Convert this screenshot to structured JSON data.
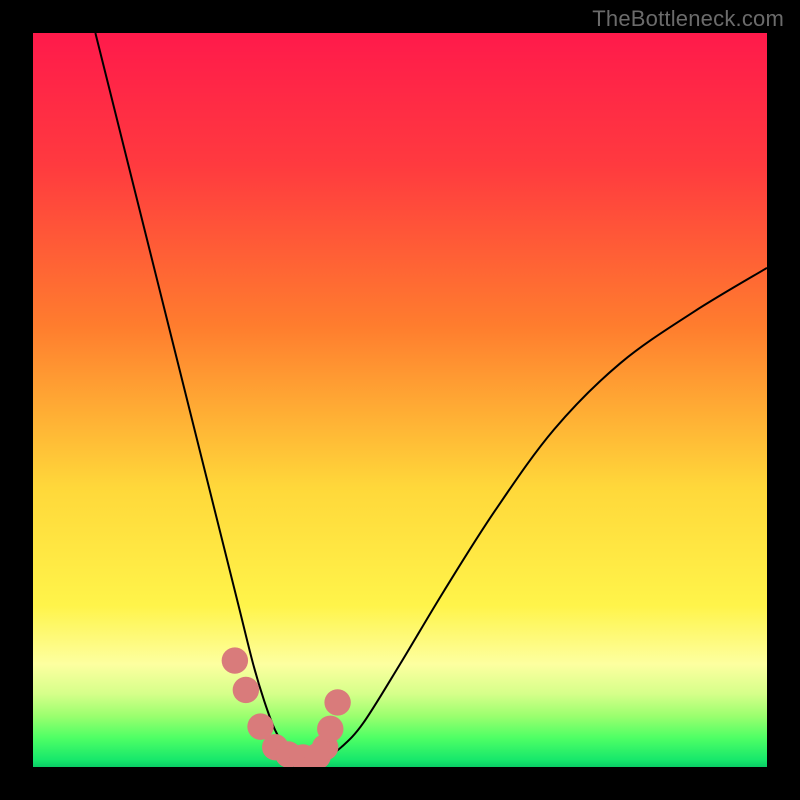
{
  "watermark": "TheBottleneck.com",
  "chart_data": {
    "type": "line",
    "title": "",
    "xlabel": "",
    "ylabel": "",
    "xlim": [
      0,
      100
    ],
    "ylim": [
      0,
      100
    ],
    "grid": false,
    "legend": false,
    "gradient_stops": [
      {
        "pct": 0,
        "color": "#ff1a4b"
      },
      {
        "pct": 18,
        "color": "#ff3a3f"
      },
      {
        "pct": 40,
        "color": "#ff7d2e"
      },
      {
        "pct": 62,
        "color": "#ffd83a"
      },
      {
        "pct": 78,
        "color": "#fff44a"
      },
      {
        "pct": 86,
        "color": "#fdffa0"
      },
      {
        "pct": 90,
        "color": "#d6ff8a"
      },
      {
        "pct": 93,
        "color": "#9cff6f"
      },
      {
        "pct": 96,
        "color": "#4fff65"
      },
      {
        "pct": 99,
        "color": "#17e86b"
      },
      {
        "pct": 100,
        "color": "#0acd65"
      }
    ],
    "series": [
      {
        "name": "bottleneck-curve",
        "color": "#000000",
        "width": 2,
        "x": [
          8.5,
          11,
          14,
          17,
          20,
          23,
          26,
          28,
          30,
          31.5,
          33,
          34.5,
          36,
          38,
          40,
          42,
          45,
          50,
          56,
          63,
          71,
          80,
          90,
          100
        ],
        "y": [
          100,
          90,
          78,
          66,
          54,
          42,
          30,
          22,
          14,
          9,
          5,
          2.7,
          1.7,
          1.3,
          1.5,
          2.7,
          6,
          14,
          24,
          35,
          46,
          55,
          62,
          68
        ]
      }
    ],
    "markers": {
      "name": "data-points",
      "color": "#d97b7b",
      "radius_frac": 0.018,
      "x": [
        27.5,
        29.0,
        31.0,
        33.0,
        34.8,
        36.8,
        38.8,
        39.8,
        40.5,
        41.5
      ],
      "y": [
        14.5,
        10.5,
        5.5,
        2.7,
        1.7,
        1.3,
        1.5,
        2.7,
        5.2,
        8.8
      ]
    }
  }
}
